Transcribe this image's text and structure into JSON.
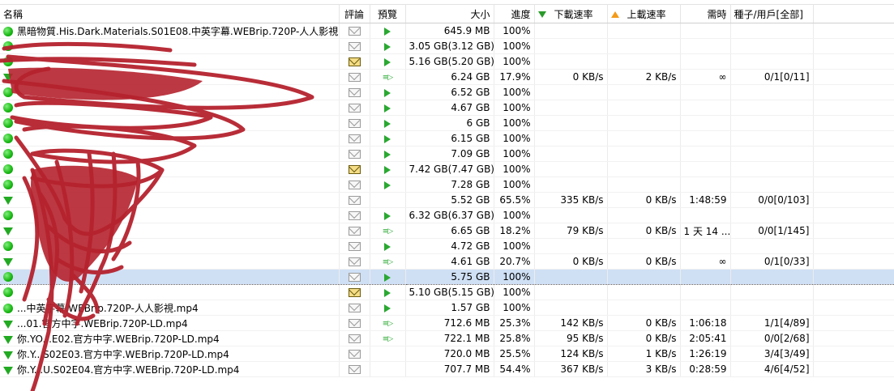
{
  "columns": {
    "name": "名稱",
    "comments": "評論",
    "preview": "預覽",
    "size": "大小",
    "progress": "進度",
    "download_speed": "下載速率",
    "upload_speed": "上載速率",
    "eta": "需時",
    "seeds_peers": "種子/用戶[全部]"
  },
  "colors": {
    "selected_row": "#cfe0f5",
    "status_green": "#17b612",
    "scribble": "#b5222e"
  },
  "rows": [
    {
      "status": "complete",
      "name": "黑暗物質.His.Dark.Materials.S01E08.中英字幕.WEBrip.720P-人人影視...",
      "comment": "mail",
      "preview": "play",
      "size": "645.9 MB",
      "progress": "100%",
      "dl": "",
      "ul": "",
      "eta": "",
      "seeds": ""
    },
    {
      "status": "complete",
      "name": "",
      "comment": "mail",
      "preview": "play",
      "size": "3.05 GB(3.12 GB)",
      "progress": "100%",
      "dl": "",
      "ul": "",
      "eta": "",
      "seeds": ""
    },
    {
      "status": "complete",
      "name": "",
      "comment": "mail-new",
      "preview": "play",
      "size": "5.16 GB(5.20 GB)",
      "progress": "100%",
      "dl": "",
      "ul": "",
      "eta": "",
      "seeds": ""
    },
    {
      "status": "downloading",
      "name": "",
      "comment": "mail",
      "preview": "stream",
      "size": "6.24 GB",
      "progress": "17.9%",
      "dl": "0 KB/s",
      "ul": "2 KB/s",
      "eta": "∞",
      "seeds": "0/1[0/11]"
    },
    {
      "status": "complete",
      "name": "",
      "comment": "mail",
      "preview": "play",
      "size": "6.52 GB",
      "progress": "100%",
      "dl": "",
      "ul": "",
      "eta": "",
      "seeds": ""
    },
    {
      "status": "complete",
      "name": "",
      "comment": "mail",
      "preview": "play",
      "size": "4.67 GB",
      "progress": "100%",
      "dl": "",
      "ul": "",
      "eta": "",
      "seeds": ""
    },
    {
      "status": "complete",
      "name": "",
      "comment": "mail",
      "preview": "play",
      "size": "6 GB",
      "progress": "100%",
      "dl": "",
      "ul": "",
      "eta": "",
      "seeds": ""
    },
    {
      "status": "complete",
      "name": "",
      "comment": "mail",
      "preview": "play",
      "size": "6.15 GB",
      "progress": "100%",
      "dl": "",
      "ul": "",
      "eta": "",
      "seeds": ""
    },
    {
      "status": "complete",
      "name": "",
      "comment": "mail",
      "preview": "play",
      "size": "7.09 GB",
      "progress": "100%",
      "dl": "",
      "ul": "",
      "eta": "",
      "seeds": ""
    },
    {
      "status": "complete",
      "name": "",
      "comment": "mail-new",
      "preview": "play",
      "size": "7.42 GB(7.47 GB)",
      "progress": "100%",
      "dl": "",
      "ul": "",
      "eta": "",
      "seeds": ""
    },
    {
      "status": "complete",
      "name": "",
      "comment": "mail",
      "preview": "play",
      "size": "7.28 GB",
      "progress": "100%",
      "dl": "",
      "ul": "",
      "eta": "",
      "seeds": ""
    },
    {
      "status": "downloading",
      "name": "",
      "comment": "mail",
      "preview": "",
      "size": "5.52 GB",
      "progress": "65.5%",
      "dl": "335 KB/s",
      "ul": "0 KB/s",
      "eta": "1:48:59",
      "seeds": "0/0[0/103]"
    },
    {
      "status": "complete",
      "name": "",
      "comment": "mail",
      "preview": "play",
      "size": "6.32 GB(6.37 GB)",
      "progress": "100%",
      "dl": "",
      "ul": "",
      "eta": "",
      "seeds": ""
    },
    {
      "status": "downloading",
      "name": "",
      "comment": "mail",
      "preview": "stream",
      "size": "6.65 GB",
      "progress": "18.2%",
      "dl": "79 KB/s",
      "ul": "0 KB/s",
      "eta": "1 天 14 ...",
      "seeds": "0/0[1/145]"
    },
    {
      "status": "complete",
      "name": "",
      "comment": "mail",
      "preview": "play",
      "size": "4.72 GB",
      "progress": "100%",
      "dl": "",
      "ul": "",
      "eta": "",
      "seeds": ""
    },
    {
      "status": "downloading",
      "name": "",
      "comment": "mail",
      "preview": "stream",
      "size": "4.61 GB",
      "progress": "20.7%",
      "dl": "0 KB/s",
      "ul": "0 KB/s",
      "eta": "∞",
      "seeds": "0/1[0/33]"
    },
    {
      "status": "complete",
      "name": "",
      "comment": "mail",
      "preview": "play",
      "size": "5.75 GB",
      "progress": "100%",
      "dl": "",
      "ul": "",
      "eta": "",
      "seeds": "",
      "selected": true
    },
    {
      "status": "complete",
      "name": "",
      "comment": "mail-new",
      "preview": "play",
      "size": "5.10 GB(5.15 GB)",
      "progress": "100%",
      "dl": "",
      "ul": "",
      "eta": "",
      "seeds": ""
    },
    {
      "status": "complete",
      "name": "...中英字幕.WEBrip.720P-人人影視.mp4",
      "comment": "mail",
      "preview": "play",
      "size": "1.57 GB",
      "progress": "100%",
      "dl": "",
      "ul": "",
      "eta": "",
      "seeds": ""
    },
    {
      "status": "downloading",
      "name": "...01.官方中字.WEBrip.720P-LD.mp4",
      "comment": "mail",
      "preview": "stream",
      "size": "712.6 MB",
      "progress": "25.3%",
      "dl": "142 KB/s",
      "ul": "0 KB/s",
      "eta": "1:06:18",
      "seeds": "1/1[4/89]"
    },
    {
      "status": "downloading",
      "name": "你.YO...E02.官方中字.WEBrip.720P-LD.mp4",
      "comment": "mail",
      "preview": "stream",
      "size": "722.1 MB",
      "progress": "25.8%",
      "dl": "95 KB/s",
      "ul": "0 KB/s",
      "eta": "2:05:41",
      "seeds": "0/0[2/68]"
    },
    {
      "status": "downloading",
      "name": "你.Y...S02E03.官方中字.WEBrip.720P-LD.mp4",
      "comment": "mail",
      "preview": "",
      "size": "720.0 MB",
      "progress": "25.5%",
      "dl": "124 KB/s",
      "ul": "1 KB/s",
      "eta": "1:26:19",
      "seeds": "3/4[3/49]"
    },
    {
      "status": "downloading",
      "name": "你.Y...U.S02E04.官方中字.WEBrip.720P-LD.mp4",
      "comment": "mail",
      "preview": "",
      "size": "707.7 MB",
      "progress": "54.4%",
      "dl": "367 KB/s",
      "ul": "3 KB/s",
      "eta": "0:28:59",
      "seeds": "4/6[4/52]"
    }
  ]
}
